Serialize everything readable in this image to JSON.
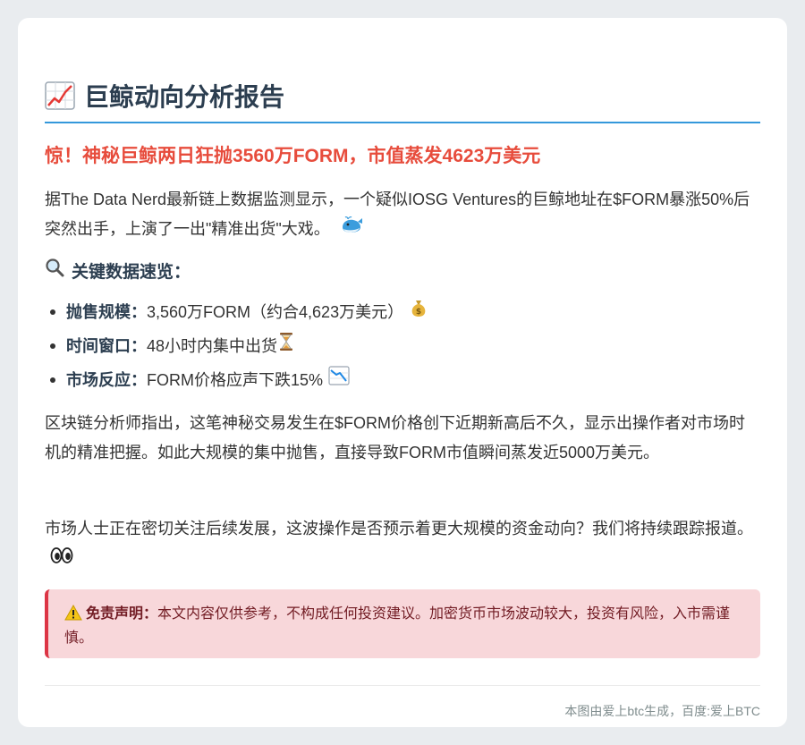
{
  "header": {
    "icon": "chart-increasing-icon",
    "title": "巨鲸动向分析报告"
  },
  "headline": "惊！神秘巨鲸两日狂抛3560万FORM，市值蒸发4623万美元",
  "intro": "据The Data Nerd最新链上数据监测显示，一个疑似IOSG Ventures的巨鲸地址在$FORM暴涨50%后突然出手，上演了一出\"精准出货\"大戏。",
  "key_section": {
    "icon": "magnifying-glass-icon",
    "title": "关键数据速览：",
    "items": [
      {
        "label": "抛售规模：",
        "value": "3,560万FORM（约合4,623万美元）",
        "icon": "money-bag-icon"
      },
      {
        "label": "时间窗口：",
        "value": "48小时内集中出货",
        "icon": "hourglass-icon"
      },
      {
        "label": "市场反应：",
        "value": "FORM价格应声下跌15%",
        "icon": "chart-decreasing-icon"
      }
    ]
  },
  "analysis": "区块链分析师指出，这笔神秘交易发生在$FORM价格创下近期新高后不久，显示出操作者对市场时机的精准把握。如此大规模的集中抛售，直接导致FORM市值瞬间蒸发近5000万美元。",
  "outlook": "市场人士正在密切关注后续发展，这波操作是否预示着更大规模的资金动向？我们将持续跟踪报道。",
  "disclaimer": {
    "icon": "warning-icon",
    "label": "免责声明：",
    "text": "本文内容仅供参考，不构成任何投资建议。加密货币市场波动较大，投资有风险，入市需谨慎。"
  },
  "footer": "本图由爱上btc生成，百度:爱上BTC",
  "colors": {
    "accent_blue": "#3498db",
    "headline_red": "#e74c3c",
    "disclaimer_bg": "#f8d7da",
    "disclaimer_border": "#dc3545"
  }
}
